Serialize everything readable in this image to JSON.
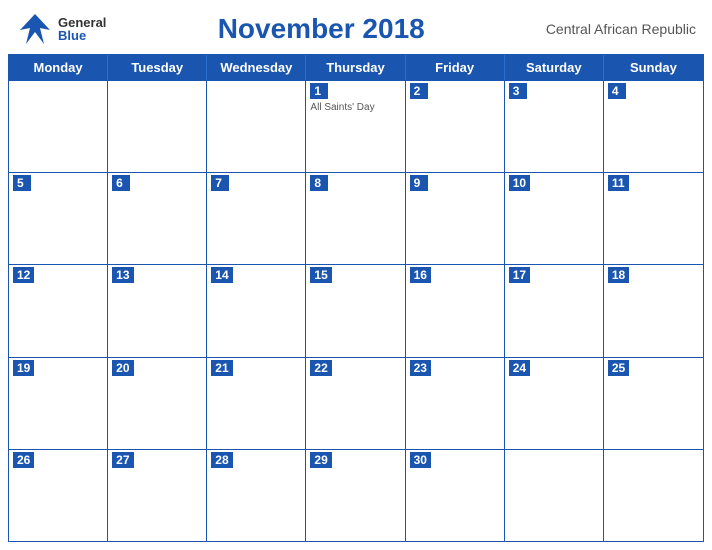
{
  "header": {
    "logo_general": "General",
    "logo_blue": "Blue",
    "title": "November 2018",
    "subtitle": "Central African Republic"
  },
  "days": [
    "Monday",
    "Tuesday",
    "Wednesday",
    "Thursday",
    "Friday",
    "Saturday",
    "Sunday"
  ],
  "weeks": [
    [
      {
        "num": "",
        "event": ""
      },
      {
        "num": "",
        "event": ""
      },
      {
        "num": "",
        "event": ""
      },
      {
        "num": "1",
        "event": "All Saints' Day"
      },
      {
        "num": "2",
        "event": ""
      },
      {
        "num": "3",
        "event": ""
      },
      {
        "num": "4",
        "event": ""
      }
    ],
    [
      {
        "num": "5",
        "event": ""
      },
      {
        "num": "6",
        "event": ""
      },
      {
        "num": "7",
        "event": ""
      },
      {
        "num": "8",
        "event": ""
      },
      {
        "num": "9",
        "event": ""
      },
      {
        "num": "10",
        "event": ""
      },
      {
        "num": "11",
        "event": ""
      }
    ],
    [
      {
        "num": "12",
        "event": ""
      },
      {
        "num": "13",
        "event": ""
      },
      {
        "num": "14",
        "event": ""
      },
      {
        "num": "15",
        "event": ""
      },
      {
        "num": "16",
        "event": ""
      },
      {
        "num": "17",
        "event": ""
      },
      {
        "num": "18",
        "event": ""
      }
    ],
    [
      {
        "num": "19",
        "event": ""
      },
      {
        "num": "20",
        "event": ""
      },
      {
        "num": "21",
        "event": ""
      },
      {
        "num": "22",
        "event": ""
      },
      {
        "num": "23",
        "event": ""
      },
      {
        "num": "24",
        "event": ""
      },
      {
        "num": "25",
        "event": ""
      }
    ],
    [
      {
        "num": "26",
        "event": ""
      },
      {
        "num": "27",
        "event": ""
      },
      {
        "num": "28",
        "event": ""
      },
      {
        "num": "29",
        "event": ""
      },
      {
        "num": "30",
        "event": ""
      },
      {
        "num": "",
        "event": ""
      },
      {
        "num": "",
        "event": ""
      }
    ]
  ]
}
